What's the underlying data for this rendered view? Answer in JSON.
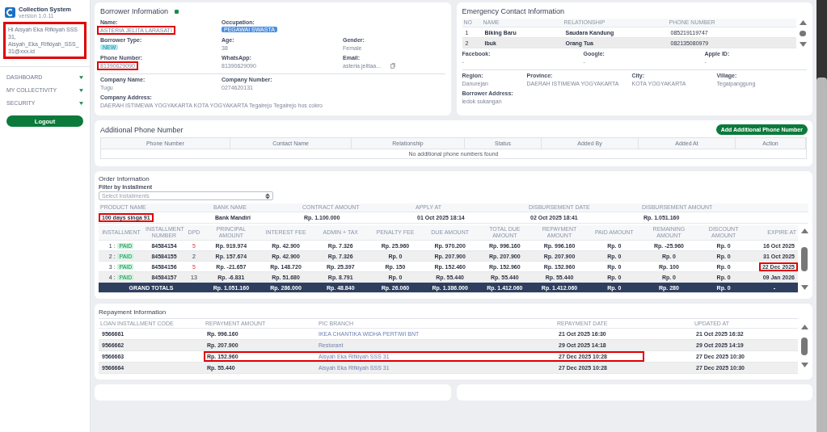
{
  "sidebar": {
    "app_name": "Collection System",
    "version": "version 1.0.11",
    "greeting": "Hi Aisyah Eka Rifkiyah SSS 31,",
    "email": "Aisyah_Eka_Rifkiyah_SSS_31@xxx.id",
    "greeting_highlighted": true,
    "menu": [
      {
        "label": "DASHBOARD",
        "expanded": false
      },
      {
        "label": "MY COLLECTIVITY",
        "expanded": false
      },
      {
        "label": "SECURITY",
        "expanded": false
      }
    ],
    "logout": "Logout"
  },
  "borrower": {
    "title": "Borrower Information",
    "rows": [
      [
        {
          "label": "Name:",
          "value": "ASTERIA JELITA LARASATI",
          "kind": "text",
          "highlighted": true
        },
        {
          "label": "Occupation:",
          "value": "PEGAWAI SWASTA",
          "kind": "badge",
          "color": "#4a8fe0"
        }
      ],
      [
        {
          "label": "Borrower Type:",
          "value": "NEW",
          "kind": "badge",
          "color": "#aeeaf3"
        },
        {
          "label": "Age:",
          "value": "38",
          "kind": "text"
        },
        {
          "label": "Gender:",
          "value": "Female",
          "kind": "text"
        }
      ],
      [
        {
          "label": "Phone Number:",
          "value": "81390629090",
          "kind": "text",
          "highlighted": true
        },
        {
          "label": "WhatsApp:",
          "value": "81390629090",
          "kind": "text"
        },
        {
          "label": "Email:",
          "value": "asteria.jelitaa...",
          "kind": "copy"
        }
      ]
    ],
    "company_rows": [
      [
        {
          "label": "Company Name:",
          "value": "Tugu",
          "kind": "text"
        },
        {
          "label": "Company Number:",
          "value": "0274620131",
          "kind": "text"
        }
      ],
      [
        {
          "label": "Company Address:",
          "value": "DAERAH ISTIMEWA YOGYAKARTA KOTA YOGYAKARTA Tegalrejo Tegalrejo hos cokro",
          "kind": "text"
        }
      ]
    ]
  },
  "emergency": {
    "title": "Emergency Contact Information",
    "columns": [
      "NO",
      "NAME",
      "RELATIONSHIP",
      "PHONE NUMBER"
    ],
    "rows": [
      [
        "1",
        "Biking Baru",
        "Saudara Kandung",
        "085219119747"
      ],
      [
        "2",
        "Ibuk",
        "Orang Tua",
        "082135080979"
      ]
    ],
    "social": [
      {
        "label": "Facebook:",
        "value": "-"
      },
      {
        "label": "Google:",
        "value": "-"
      },
      {
        "label": "Apple ID:",
        "value": "-"
      }
    ],
    "address": [
      {
        "label": "Region:",
        "value": "Danurejan"
      },
      {
        "label": "Province:",
        "value": "DAERAH ISTIMEWA YOGYAKARTA"
      },
      {
        "label": "City:",
        "value": "KOTA YOGYAKARTA"
      },
      {
        "label": "Village:",
        "value": "Tegalpanggung"
      }
    ],
    "borrower_address": {
      "label": "Borrower Address:",
      "value": "ledok sukangan"
    }
  },
  "additional_phone": {
    "title": "Additional Phone Number",
    "button": "Add Additional Phone Number",
    "columns": [
      "Phone Number",
      "Contact Name",
      "Relationship",
      "Status",
      "Added By",
      "Added At",
      "Action"
    ],
    "empty": "No additional phone numbers found"
  },
  "order": {
    "title": "Order Information",
    "filter_label": "Filter by Installment",
    "filter_placeholder": "Select Installments",
    "product_columns": [
      "PRODUCT NAME",
      "BANK NAME",
      "CONTRACT AMOUNT",
      "APPLY AT",
      "DISBURSEMENT DATE",
      "DISBURSEMENT AMOUNT"
    ],
    "product_row": [
      {
        "text": "100 days singa 91",
        "highlighted": true
      },
      {
        "text": "Bank Mandiri",
        "highlighted": false
      },
      {
        "text": "Rp. 1.100.000",
        "highlighted": false
      },
      {
        "text": "01 Oct 2025 18:14",
        "highlighted": false
      },
      {
        "text": "02 Oct 2025 18:41",
        "highlighted": false
      },
      {
        "text": "Rp. 1.051.160",
        "highlighted": false
      }
    ],
    "installment_columns": [
      "INSTALLMENT",
      "INSTALLMENT NUMBER",
      "DPD",
      "PRINCIPAL AMOUNT",
      "INTEREST FEE",
      "ADMIN + TAX",
      "PENALTY FEE",
      "DUE AMOUNT",
      "TOTAL DUE AMOUNT",
      "REPAYMENT AMOUNT",
      "PAID AMOUNT",
      "REMAINING AMOUNT",
      "DISCOUNT AMOUNT",
      "EXPIRE AT"
    ],
    "installments": [
      {
        "kind": "row",
        "installment": "1 :",
        "status": "PAID",
        "number": "84584154",
        "dpd": "5",
        "dpd_late": true,
        "cells": [
          "Rp. 919.974",
          "Rp. 42.900",
          "Rp. 7.326",
          "Rp. 25.960",
          "Rp. 970.200",
          "Rp. 996.160",
          "Rp. 996.160",
          "Rp. 0",
          "Rp. -25.960",
          "Rp. 0"
        ],
        "expire": "16 Oct 2025",
        "expire_highlighted": false
      },
      {
        "kind": "row",
        "installment": "2 :",
        "status": "PAID",
        "number": "84584155",
        "dpd": "2",
        "dpd_late": false,
        "cells": [
          "Rp. 157.674",
          "Rp. 42.900",
          "Rp. 7.326",
          "Rp. 0",
          "Rp. 207.900",
          "Rp. 207.900",
          "Rp. 207.900",
          "Rp. 0",
          "Rp. 0",
          "Rp. 0"
        ],
        "expire": "31 Oct 2025",
        "expire_highlighted": false
      },
      {
        "kind": "row",
        "installment": "3 :",
        "status": "PAID",
        "number": "84584156",
        "dpd": "5",
        "dpd_late": true,
        "cells": [
          "Rp. -21.657",
          "Rp. 148.720",
          "Rp. 25.397",
          "Rp. 150",
          "Rp. 152.460",
          "Rp. 152.960",
          "Rp. 152.960",
          "Rp. 0",
          "Rp. 100",
          "Rp. 0"
        ],
        "expire": "22 Dec 2025",
        "expire_highlighted": true
      },
      {
        "kind": "row",
        "installment": "4 :",
        "status": "PAID",
        "number": "84584157",
        "dpd": "13",
        "dpd_late": false,
        "cells": [
          "Rp. -6.831",
          "Rp. 51.680",
          "Rp. 8.791",
          "Rp. 0",
          "Rp. 55.440",
          "Rp. 55.440",
          "Rp. 55.440",
          "Rp. 0",
          "Rp. 0",
          "Rp. 0"
        ],
        "expire": "09 Jan 2026",
        "expire_highlighted": false
      },
      {
        "kind": "total",
        "installment": "GRAND TOTALS",
        "cells": [
          "Rp. 1.051.160",
          "Rp. 286.000",
          "Rp. 48.840",
          "Rp. 26.060",
          "Rp. 1.386.000",
          "Rp. 1.412.060",
          "Rp. 1.412.060",
          "Rp. 0",
          "Rp. 280",
          "Rp. 0"
        ],
        "expire": "-"
      }
    ]
  },
  "repayment": {
    "title": "Repayment Information",
    "columns": [
      "LOAN INSTALLMENT CODE",
      "REPAYMENT AMOUNT",
      "PIC BRANCH",
      "REPAYMENT DATE",
      "UPDATED AT"
    ],
    "rows": [
      {
        "code": "9566661",
        "amount": "Rp. 996.160",
        "pic": "IKEA CHANTIKA WIDHA PERTIWI BNT",
        "date": "21 Oct 2025 16:30",
        "updated": "21 Oct 2025 16:32",
        "highlighted": false
      },
      {
        "code": "9566662",
        "amount": "Rp. 207.900",
        "pic": "Restorant",
        "date": "29 Oct 2025 14:18",
        "updated": "29 Oct 2025 14:19",
        "highlighted": false
      },
      {
        "code": "9566663",
        "amount": "Rp. 152.960",
        "pic": "Aisyah Eka Rifkiyah SSS 31",
        "date": "27 Dec 2025 10:28",
        "updated": "27 Dec 2025 10:30",
        "highlighted": true
      },
      {
        "code": "9566664",
        "amount": "Rp. 55.440",
        "pic": "Aisyah Eka Rifkiyah SSS 31",
        "date": "27 Dec 2025 10:28",
        "updated": "27 Dec 2025 10:30",
        "highlighted": false
      }
    ]
  }
}
